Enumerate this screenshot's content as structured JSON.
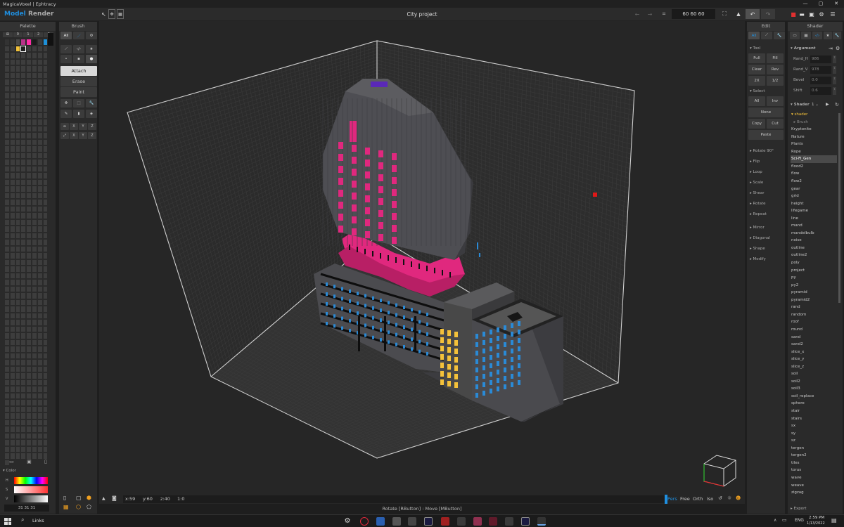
{
  "window": {
    "title": "MagicaVoxel | Ephtracy",
    "min": "—",
    "max": "▢",
    "close": "✕"
  },
  "menu": {
    "model": "Model",
    "render": "Render",
    "project": "City project"
  },
  "toolbar": {
    "size": "60  60  60"
  },
  "palette": {
    "title": "Palette",
    "tabs": [
      "⊞",
      "0",
      "1",
      "2",
      "3"
    ],
    "color_label": "Color",
    "rgb": "31  31  31",
    "h": "H",
    "s": "S",
    "v": "V"
  },
  "brush": {
    "title": "Brush",
    "all": "All",
    "modes": [
      "Attach",
      "Erase",
      "Paint"
    ],
    "axes": [
      "X",
      "Y",
      "Z"
    ]
  },
  "edit": {
    "title": "Edit",
    "all": "All",
    "tool_label": "Tool",
    "tool_buttons": [
      "Full",
      "Fill",
      "Clear",
      "Rev",
      "2X",
      "1/2"
    ],
    "select_label": "Select",
    "select_buttons": [
      "All",
      "Inv",
      "None",
      "Copy",
      "Cut",
      "Paste"
    ],
    "groups1": [
      "Rotate 90°",
      "Flip",
      "Loop",
      "Scale",
      "Shear",
      "Rotate",
      "Repeat"
    ],
    "groups2": [
      "Mirror",
      "Diagonal",
      "Shape",
      "Modify"
    ]
  },
  "shader": {
    "title": "Shader",
    "argument_label": "Argument",
    "args": [
      {
        "name": "Rand_H",
        "value": "986"
      },
      {
        "name": "Rand_V",
        "value": "978"
      },
      {
        "name": "Bevel",
        "value": "0.0"
      },
      {
        "name": "Shift",
        "value": "0.6"
      }
    ],
    "shader_label": "Shader",
    "shader_count": "1",
    "items": [
      "shader",
      "Brush",
      "Kryptonite",
      "Nature",
      "Plants",
      "Rope",
      "Sci-Fi_Gen",
      "flood2",
      "flow",
      "flow2",
      "gear",
      "grid",
      "height",
      "lifegame",
      "line",
      "mand",
      "mandelbulb",
      "noise",
      "outline",
      "outline2",
      "poly",
      "project",
      "py",
      "py2",
      "pyramid",
      "pyramid2",
      "rand",
      "random",
      "roof",
      "round",
      "sand",
      "sand2",
      "slice_x",
      "slice_y",
      "slice_z",
      "soil",
      "soil2",
      "soil3",
      "soil_replace",
      "sphere",
      "stair",
      "stairs",
      "sx",
      "sy",
      "sz",
      "tergen",
      "tergen2",
      "tiles",
      "torus",
      "wave",
      "weave",
      "zigzag"
    ],
    "selected": "Sci-Fi_Gen",
    "export": "Export"
  },
  "status": {
    "x": "x:59",
    "y": "y:60",
    "z": "z:40",
    "ratio": "1:0",
    "views": [
      "Pers",
      "Free",
      "Orth",
      "Iso"
    ],
    "hint": "Rotate [RButton] : Move [MButton]"
  },
  "taskbar": {
    "links": "Links",
    "time": "2:59 PM",
    "date": "1/13/2022",
    "lang": "ENG"
  },
  "colors": {
    "accent": "#1f8fe0",
    "magenta": "#e0287e",
    "blue": "#2a8ad6",
    "yellow": "#f4c13a",
    "bg": "#1e1e1e"
  }
}
